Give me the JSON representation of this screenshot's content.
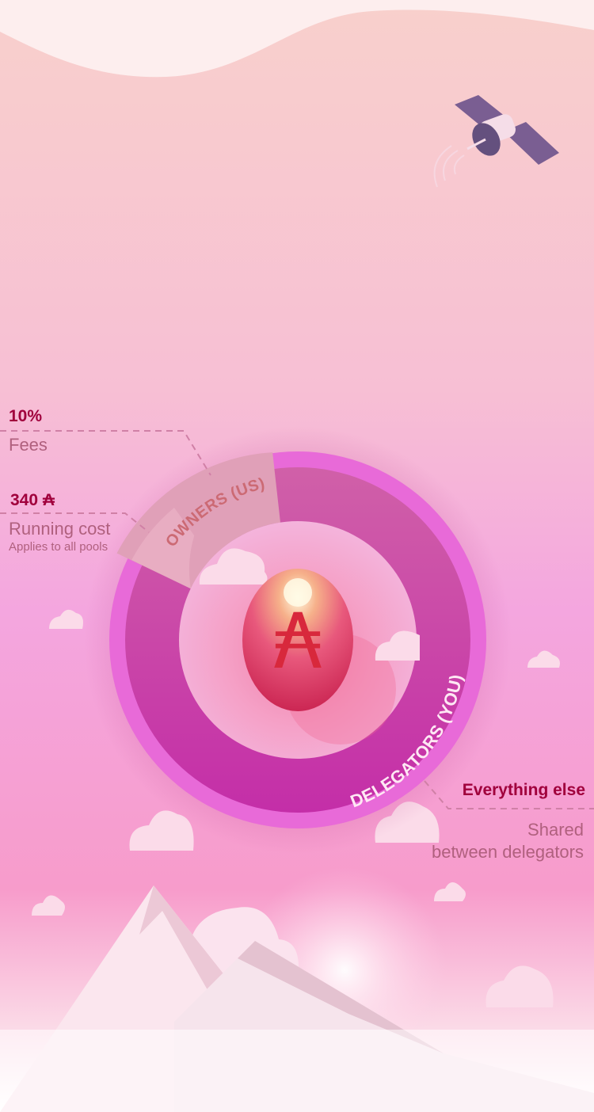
{
  "colors": {
    "accent": "#a0003c",
    "label": "#b0607e",
    "ring_outer": "#e86ad8",
    "ring_delegators": "#c83aa8",
    "ring_owners": "#e0a0b8",
    "egg": "#e2456f",
    "ada_symbol": "#d8283c"
  },
  "icons": {
    "currency": "ada-symbol-icon",
    "satellite": "satellite-icon",
    "egg": "egg-icon",
    "cloud": "cloud-icon",
    "mountain": "mountain-icon"
  },
  "fees": {
    "value": "10%",
    "label": "Fees"
  },
  "running_cost": {
    "value": "340 ₳",
    "label": "Running cost",
    "note": "Applies to all pools"
  },
  "everything_else": {
    "value": "Everything else",
    "label_line1": "Shared",
    "label_line2": "between delegators"
  },
  "ring": {
    "owners_label": "OWNERS (US)",
    "delegators_label": "DELEGATORS (YOU)",
    "center_symbol": "₳"
  }
}
